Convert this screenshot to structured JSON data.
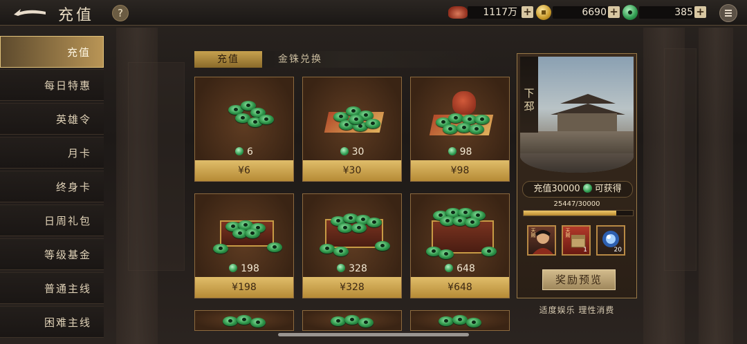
{
  "header": {
    "title": "充值",
    "help_label": "?",
    "resources": [
      {
        "icon": "ingot-icon",
        "value": "1117万"
      },
      {
        "icon": "gold-coin-icon",
        "value": "6690"
      },
      {
        "icon": "jade-coin-icon",
        "value": "385"
      }
    ],
    "plus_label": "+"
  },
  "sidebar": {
    "items": [
      {
        "label": "充值"
      },
      {
        "label": "每日特惠"
      },
      {
        "label": "英雄令"
      },
      {
        "label": "月卡"
      },
      {
        "label": "终身卡"
      },
      {
        "label": "日周礼包"
      },
      {
        "label": "等级基金"
      },
      {
        "label": "普通主线"
      },
      {
        "label": "困难主线"
      }
    ]
  },
  "tabs": [
    {
      "label": "充值"
    },
    {
      "label": "金铢兑换"
    }
  ],
  "products": [
    {
      "amount": "6",
      "price": "¥6"
    },
    {
      "amount": "30",
      "price": "¥30"
    },
    {
      "amount": "98",
      "price": "¥98"
    },
    {
      "amount": "198",
      "price": "¥198"
    },
    {
      "amount": "328",
      "price": "¥328"
    },
    {
      "amount": "648",
      "price": "¥648"
    }
  ],
  "panel": {
    "location_chars": [
      "下",
      "邳"
    ],
    "goal_prefix": "充值30000",
    "goal_suffix": "可获得",
    "progress_text": "25447/30000",
    "progress_value": 25447,
    "progress_max": 30000,
    "rewards": [
      {
        "icon": "hero-portrait-icon",
        "tag": "天赐"
      },
      {
        "icon": "treasure-chest-icon",
        "tag": "天赐",
        "count": "1"
      },
      {
        "icon": "orb-icon",
        "count": "20"
      }
    ],
    "preview_button": "奖励预览",
    "notice": "适度娱乐 理性消费"
  },
  "colors": {
    "accent_gold": "#c7a24f",
    "jade_green": "#2e9a4f",
    "progress_fill": "#d9a84a"
  }
}
